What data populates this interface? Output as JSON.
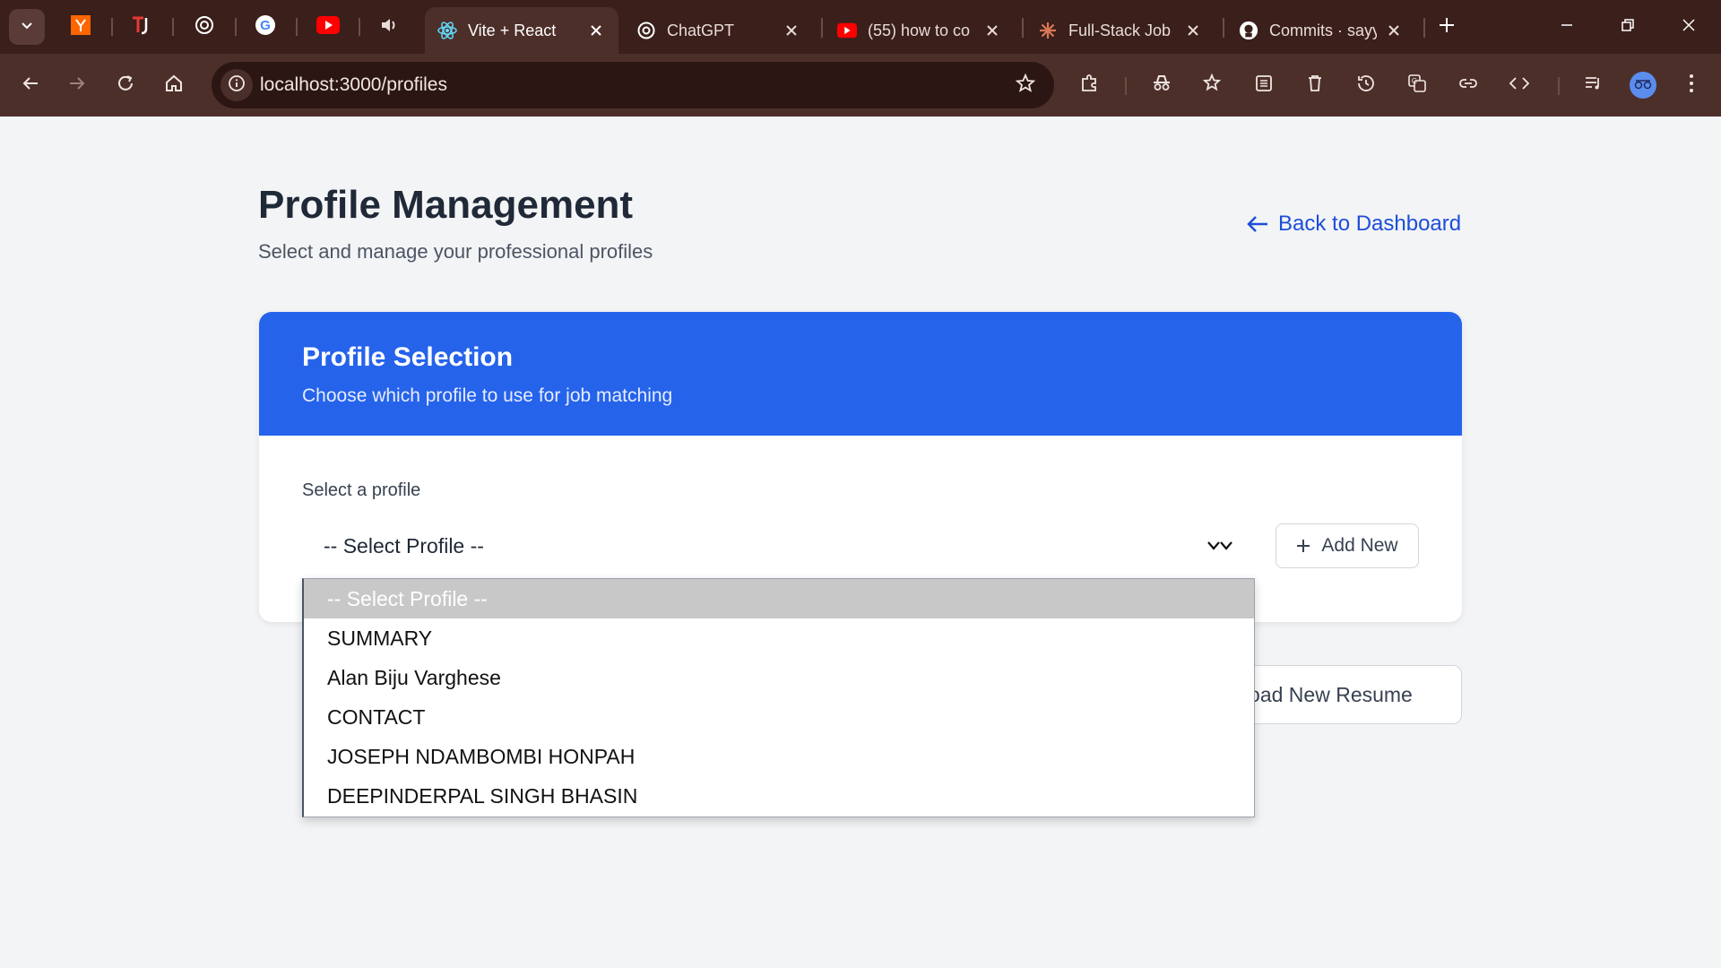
{
  "browser": {
    "tabs": [
      {
        "title": "Vite + React",
        "active": true
      },
      {
        "title": "ChatGPT",
        "active": false
      },
      {
        "title": "(55) how to co",
        "active": false
      },
      {
        "title": "Full-Stack Job",
        "active": false
      },
      {
        "title": "Commits · sayy",
        "active": false
      }
    ],
    "address": "localhost:3000/profiles"
  },
  "page": {
    "title": "Profile Management",
    "subtitle": "Select and manage your professional profiles",
    "back_link": "Back to Dashboard"
  },
  "card": {
    "title": "Profile Selection",
    "subtitle": "Choose which profile to use for job matching",
    "field_label": "Select a profile",
    "selected_value": "-- Select Profile --",
    "add_button": "Add New"
  },
  "dropdown": {
    "options": [
      "-- Select Profile --",
      "SUMMARY",
      "Alan Biju Varghese",
      "CONTACT",
      "JOSEPH NDAMBOMBI HONPAH",
      "DEEPINDERPAL SINGH BHASIN"
    ]
  },
  "upload_button": "pload New Resume",
  "colors": {
    "accent": "#2563eb",
    "link": "#1d4ed8",
    "chrome": "#4d2f2a",
    "tabstrip": "#3a1f1b"
  }
}
